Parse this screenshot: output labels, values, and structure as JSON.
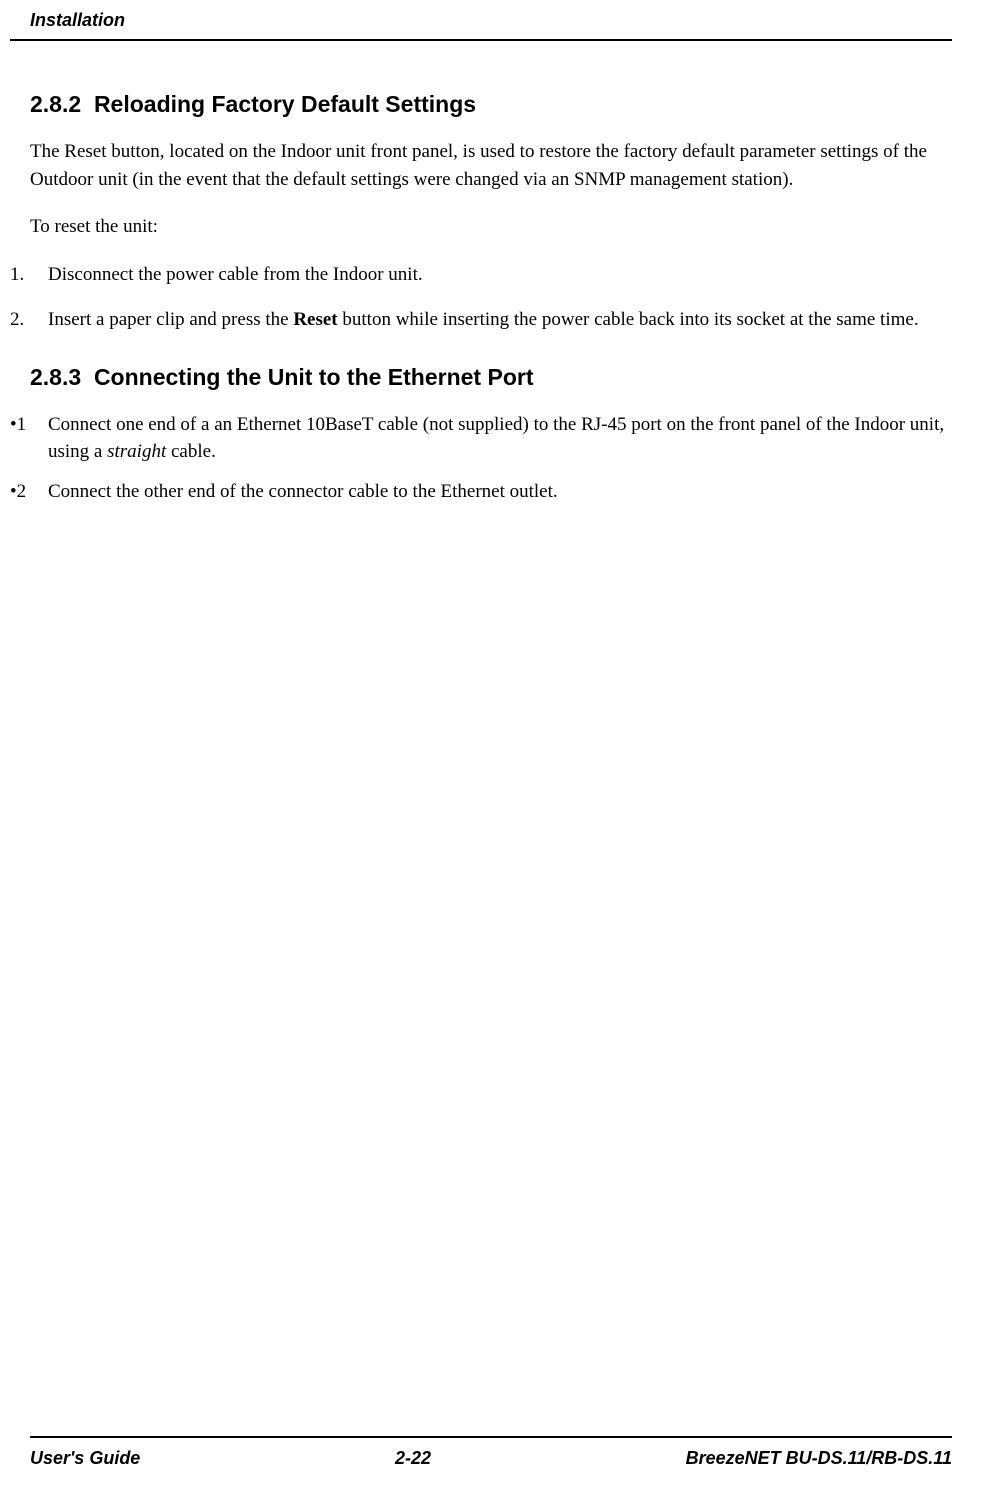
{
  "header": {
    "title": "Installation"
  },
  "sections": {
    "s1": {
      "number": "2.8.2",
      "title": "Reloading Factory Default Settings",
      "intro": "The Reset button, located on the Indoor unit front panel, is used to restore the factory default parameter settings of the Outdoor unit (in the event that the default settings were changed via an SNMP management station).",
      "lead": "To reset the unit:",
      "items": {
        "i1": {
          "marker": "1.",
          "text": "Disconnect the power cable from the Indoor unit."
        },
        "i2": {
          "marker": "2.",
          "text_before": "Insert a paper clip and press the ",
          "bold": "Reset",
          "text_after": " button while inserting the power cable back into its socket at the same time."
        }
      }
    },
    "s2": {
      "number": "2.8.3",
      "title": "Connecting the Unit to the Ethernet Port",
      "items": {
        "i1": {
          "marker": "•1",
          "text_before": "Connect one end of a an Ethernet 10BaseT cable (not supplied) to the RJ-45 port on the front panel of the Indoor unit, using a ",
          "italic": "straight",
          "text_after": " cable."
        },
        "i2": {
          "marker": "•2",
          "text": "Connect the other end of the connector cable to the Ethernet outlet."
        }
      }
    }
  },
  "footer": {
    "left": "User's Guide",
    "center": "2-22",
    "right": "BreezeNET BU-DS.11/RB-DS.11"
  }
}
